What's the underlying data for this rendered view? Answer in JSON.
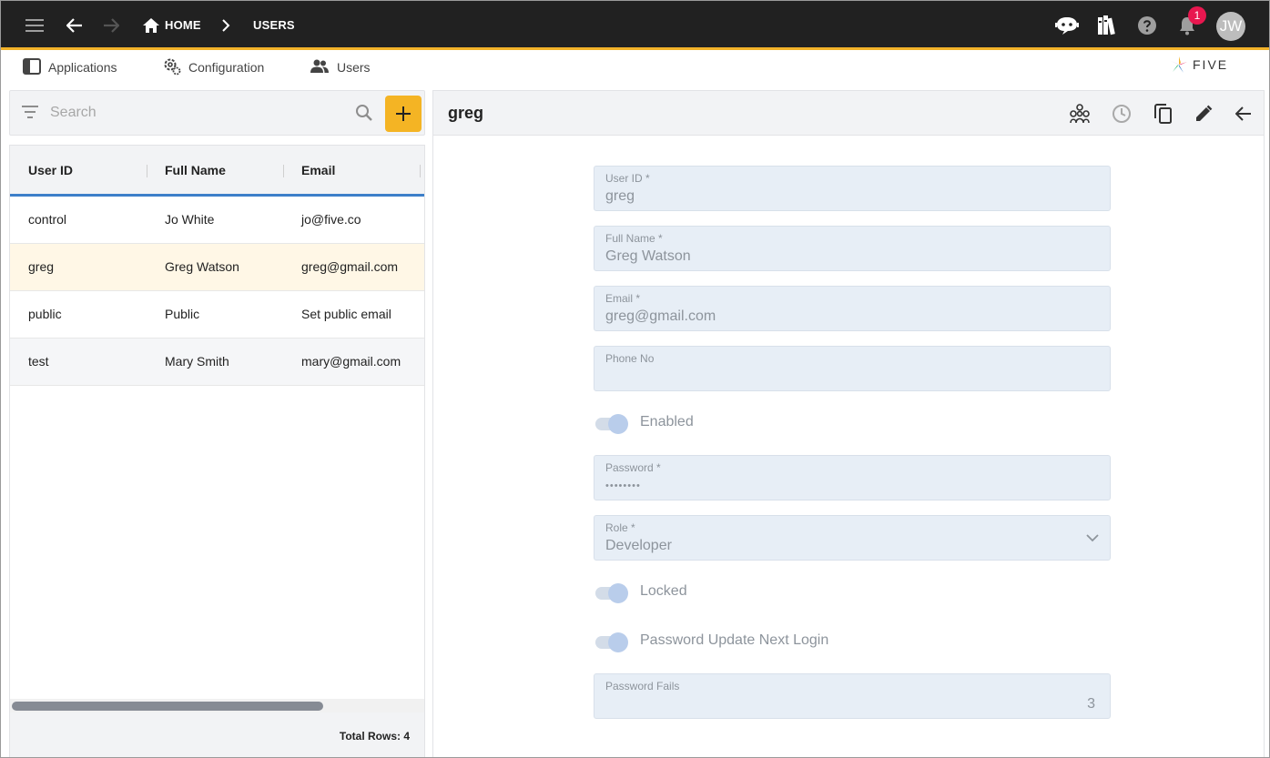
{
  "topbar": {
    "breadcrumb_home": "HOME",
    "breadcrumb_current": "USERS",
    "notification_count": "1",
    "avatar_initials": "JW"
  },
  "nav": {
    "items": [
      {
        "label": "Applications",
        "icon": "application-panel-icon"
      },
      {
        "label": "Configuration",
        "icon": "gears-icon"
      },
      {
        "label": "Users",
        "icon": "users-icon"
      }
    ],
    "logo_text": "FIVE"
  },
  "list": {
    "search_placeholder": "Search",
    "columns": [
      "User ID",
      "Full Name",
      "Email"
    ],
    "rows": [
      {
        "user_id": "control",
        "full_name": "Jo White",
        "email": "jo@five.co"
      },
      {
        "user_id": "greg",
        "full_name": "Greg Watson",
        "email": "greg@gmail.com"
      },
      {
        "user_id": "public",
        "full_name": "Public",
        "email": "Set public email"
      },
      {
        "user_id": "test",
        "full_name": "Mary Smith",
        "email": "mary@gmail.com"
      }
    ],
    "selected_row": 1,
    "total_rows_label": "Total Rows: 4"
  },
  "form": {
    "title": "greg",
    "fields": {
      "user_id": {
        "label": "User ID *",
        "value": "greg"
      },
      "full_name": {
        "label": "Full Name *",
        "value": "Greg Watson"
      },
      "email": {
        "label": "Email *",
        "value": "greg@gmail.com"
      },
      "phone": {
        "label": "Phone No",
        "value": ""
      },
      "enabled": {
        "label": "Enabled",
        "on": true
      },
      "password": {
        "label": "Password *",
        "value": "••••••••"
      },
      "role": {
        "label": "Role *",
        "value": "Developer"
      },
      "locked": {
        "label": "Locked",
        "on": true
      },
      "password_update": {
        "label": "Password Update Next Login",
        "on": true
      },
      "password_fails": {
        "label": "Password Fails",
        "value": "3"
      }
    }
  },
  "colors": {
    "appbar": "#212121",
    "accent": "#f2b229",
    "selected_row": "#fff7e6",
    "header_underline": "#3d7fc9",
    "badge": "#e8174f"
  }
}
